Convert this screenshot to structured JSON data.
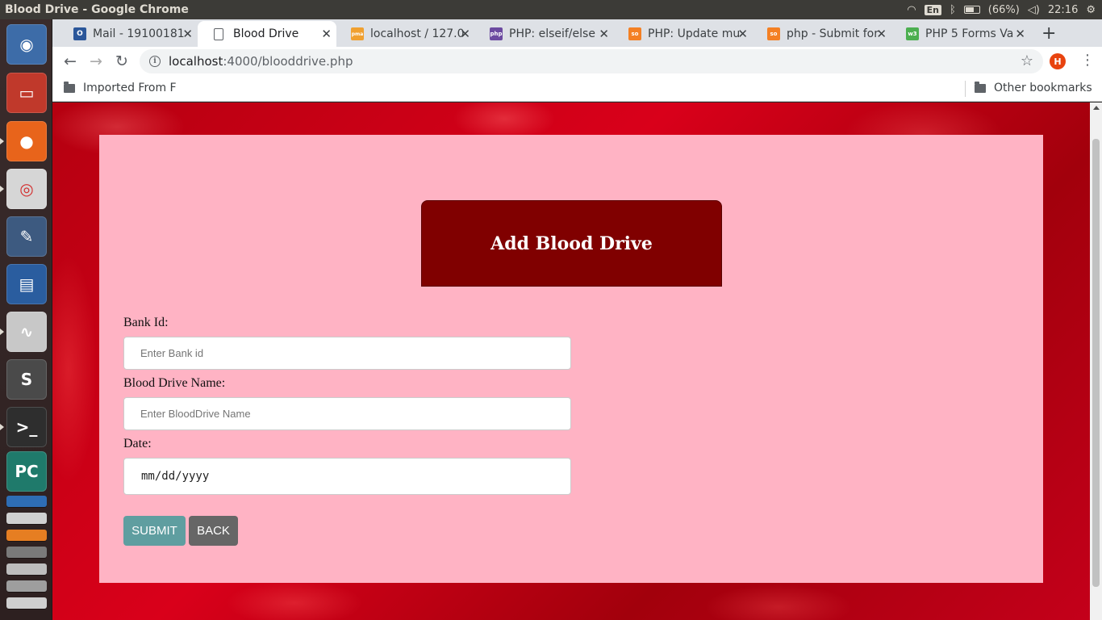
{
  "os": {
    "window_title": "Blood Drive - Google Chrome",
    "lang": "En",
    "battery": "(66%)",
    "clock": "22:16"
  },
  "launcher": {
    "items": [
      {
        "name": "ubuntu-dash-icon",
        "glyph": "◉"
      },
      {
        "name": "file-cabinet-icon",
        "glyph": "▭"
      },
      {
        "name": "firefox-icon",
        "glyph": "●"
      },
      {
        "name": "chrome-icon",
        "glyph": "◎"
      },
      {
        "name": "text-editor-icon",
        "glyph": "✎"
      },
      {
        "name": "writer-icon",
        "glyph": "▤"
      },
      {
        "name": "document-viewer-icon",
        "glyph": "∿"
      },
      {
        "name": "sublime-text-icon",
        "glyph": "S"
      },
      {
        "name": "terminal-icon",
        "glyph": ">_"
      },
      {
        "name": "pycharm-icon",
        "glyph": "PC"
      }
    ]
  },
  "browser": {
    "tabs": [
      {
        "label": "Mail - 19100181",
        "favicon": "O",
        "color": "#2b579a"
      },
      {
        "label": "Blood Drive",
        "favicon": "",
        "color": "#ffffff"
      },
      {
        "label": "localhost / 127.0",
        "favicon": "pma",
        "color": "#f0a030"
      },
      {
        "label": "PHP: elseif/else",
        "favicon": "php",
        "color": "#6c4aa0"
      },
      {
        "label": "PHP: Update mu",
        "favicon": "so",
        "color": "#f48024"
      },
      {
        "label": "php - Submit for",
        "favicon": "so",
        "color": "#f48024"
      },
      {
        "label": "PHP 5 Forms Va",
        "favicon": "w3",
        "color": "#4caf50"
      }
    ],
    "url_host": "localhost",
    "url_rest": ":4000/blooddrive.php",
    "profile_initial": "H",
    "bookmarks_left": "Imported From F",
    "bookmarks_right": "Other bookmarks"
  },
  "form": {
    "title": "Add Blood Drive",
    "bank_id_label": "Bank Id:",
    "bank_id_placeholder": "Enter Bank id",
    "drive_name_label": "Blood Drive Name:",
    "drive_name_placeholder": "Enter BloodDrive Name",
    "date_label": "Date:",
    "date_placeholder": "mm/dd/yyyy",
    "submit_label": "SUBMIT",
    "back_label": "BACK"
  },
  "colors": {
    "card_bg": "#ffb3c4",
    "header_bg": "#800000",
    "submit_bg": "#5f9ea0",
    "back_bg": "#666666"
  }
}
